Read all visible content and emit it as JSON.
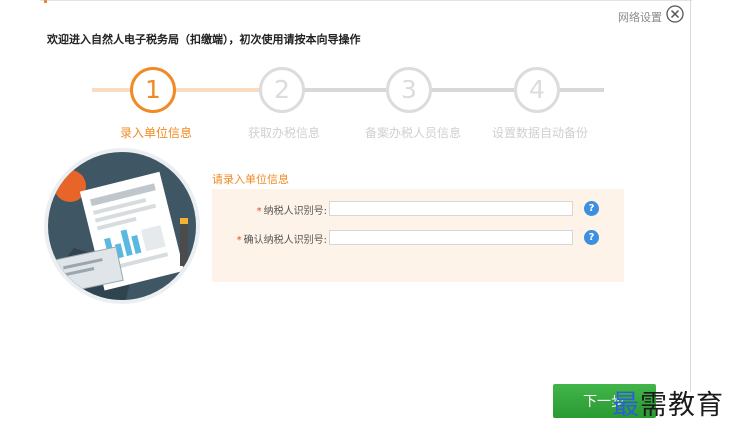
{
  "header": {
    "network_settings": "网络设置",
    "welcome": "欢迎进入自然人电子税务局（扣缴端），初次使用请按本向导操作"
  },
  "steps": [
    {
      "number": "1",
      "label": "录入单位信息",
      "state": "active"
    },
    {
      "number": "2",
      "label": "获取办税信息",
      "state": "inactive"
    },
    {
      "number": "3",
      "label": "备案办税人员信息",
      "state": "inactive"
    },
    {
      "number": "4",
      "label": "设置数据自动备份",
      "state": "inactive"
    }
  ],
  "form": {
    "heading": "请录入单位信息",
    "taxpayer_id": {
      "required_mark": "*",
      "label": "纳税人识别号:",
      "value": "",
      "help": "?"
    },
    "confirm_taxpayer_id": {
      "required_mark": "*",
      "label": "确认纳税人识别号:",
      "value": "",
      "help": "?"
    }
  },
  "footer": {
    "next_button": "下一步",
    "watermark_first": "最",
    "watermark_rest": "需教育"
  },
  "colors": {
    "accent": "#f08a24",
    "inactive": "#dcdcdc",
    "form_panel": "#fdf3e8",
    "help": "#3d8fe0",
    "next_button": "#34a83d",
    "required": "#e04a2a"
  },
  "icons": [
    "close-icon",
    "help-icon",
    "document-illustration"
  ]
}
